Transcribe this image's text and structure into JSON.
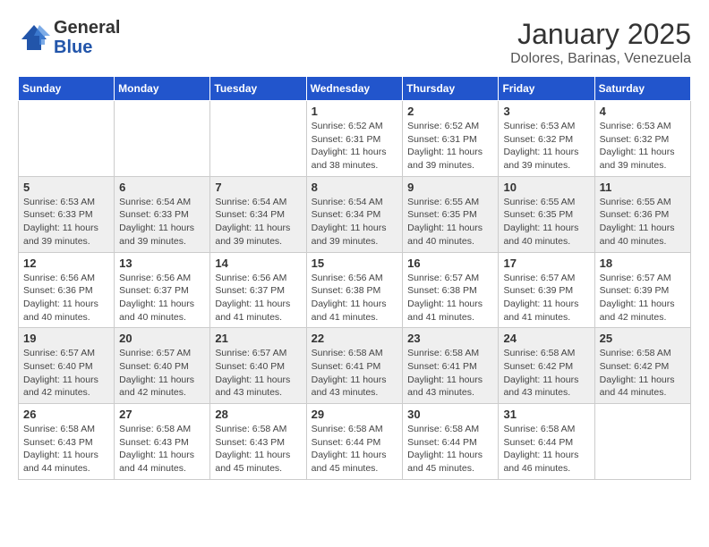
{
  "logo": {
    "general": "General",
    "blue": "Blue"
  },
  "header": {
    "month_year": "January 2025",
    "location": "Dolores, Barinas, Venezuela"
  },
  "days_of_week": [
    "Sunday",
    "Monday",
    "Tuesday",
    "Wednesday",
    "Thursday",
    "Friday",
    "Saturday"
  ],
  "weeks": [
    [
      {
        "day": "",
        "info": ""
      },
      {
        "day": "",
        "info": ""
      },
      {
        "day": "",
        "info": ""
      },
      {
        "day": "1",
        "info": "Sunrise: 6:52 AM\nSunset: 6:31 PM\nDaylight: 11 hours and 38 minutes."
      },
      {
        "day": "2",
        "info": "Sunrise: 6:52 AM\nSunset: 6:31 PM\nDaylight: 11 hours and 39 minutes."
      },
      {
        "day": "3",
        "info": "Sunrise: 6:53 AM\nSunset: 6:32 PM\nDaylight: 11 hours and 39 minutes."
      },
      {
        "day": "4",
        "info": "Sunrise: 6:53 AM\nSunset: 6:32 PM\nDaylight: 11 hours and 39 minutes."
      }
    ],
    [
      {
        "day": "5",
        "info": "Sunrise: 6:53 AM\nSunset: 6:33 PM\nDaylight: 11 hours and 39 minutes."
      },
      {
        "day": "6",
        "info": "Sunrise: 6:54 AM\nSunset: 6:33 PM\nDaylight: 11 hours and 39 minutes."
      },
      {
        "day": "7",
        "info": "Sunrise: 6:54 AM\nSunset: 6:34 PM\nDaylight: 11 hours and 39 minutes."
      },
      {
        "day": "8",
        "info": "Sunrise: 6:54 AM\nSunset: 6:34 PM\nDaylight: 11 hours and 39 minutes."
      },
      {
        "day": "9",
        "info": "Sunrise: 6:55 AM\nSunset: 6:35 PM\nDaylight: 11 hours and 40 minutes."
      },
      {
        "day": "10",
        "info": "Sunrise: 6:55 AM\nSunset: 6:35 PM\nDaylight: 11 hours and 40 minutes."
      },
      {
        "day": "11",
        "info": "Sunrise: 6:55 AM\nSunset: 6:36 PM\nDaylight: 11 hours and 40 minutes."
      }
    ],
    [
      {
        "day": "12",
        "info": "Sunrise: 6:56 AM\nSunset: 6:36 PM\nDaylight: 11 hours and 40 minutes."
      },
      {
        "day": "13",
        "info": "Sunrise: 6:56 AM\nSunset: 6:37 PM\nDaylight: 11 hours and 40 minutes."
      },
      {
        "day": "14",
        "info": "Sunrise: 6:56 AM\nSunset: 6:37 PM\nDaylight: 11 hours and 41 minutes."
      },
      {
        "day": "15",
        "info": "Sunrise: 6:56 AM\nSunset: 6:38 PM\nDaylight: 11 hours and 41 minutes."
      },
      {
        "day": "16",
        "info": "Sunrise: 6:57 AM\nSunset: 6:38 PM\nDaylight: 11 hours and 41 minutes."
      },
      {
        "day": "17",
        "info": "Sunrise: 6:57 AM\nSunset: 6:39 PM\nDaylight: 11 hours and 41 minutes."
      },
      {
        "day": "18",
        "info": "Sunrise: 6:57 AM\nSunset: 6:39 PM\nDaylight: 11 hours and 42 minutes."
      }
    ],
    [
      {
        "day": "19",
        "info": "Sunrise: 6:57 AM\nSunset: 6:40 PM\nDaylight: 11 hours and 42 minutes."
      },
      {
        "day": "20",
        "info": "Sunrise: 6:57 AM\nSunset: 6:40 PM\nDaylight: 11 hours and 42 minutes."
      },
      {
        "day": "21",
        "info": "Sunrise: 6:57 AM\nSunset: 6:40 PM\nDaylight: 11 hours and 43 minutes."
      },
      {
        "day": "22",
        "info": "Sunrise: 6:58 AM\nSunset: 6:41 PM\nDaylight: 11 hours and 43 minutes."
      },
      {
        "day": "23",
        "info": "Sunrise: 6:58 AM\nSunset: 6:41 PM\nDaylight: 11 hours and 43 minutes."
      },
      {
        "day": "24",
        "info": "Sunrise: 6:58 AM\nSunset: 6:42 PM\nDaylight: 11 hours and 43 minutes."
      },
      {
        "day": "25",
        "info": "Sunrise: 6:58 AM\nSunset: 6:42 PM\nDaylight: 11 hours and 44 minutes."
      }
    ],
    [
      {
        "day": "26",
        "info": "Sunrise: 6:58 AM\nSunset: 6:43 PM\nDaylight: 11 hours and 44 minutes."
      },
      {
        "day": "27",
        "info": "Sunrise: 6:58 AM\nSunset: 6:43 PM\nDaylight: 11 hours and 44 minutes."
      },
      {
        "day": "28",
        "info": "Sunrise: 6:58 AM\nSunset: 6:43 PM\nDaylight: 11 hours and 45 minutes."
      },
      {
        "day": "29",
        "info": "Sunrise: 6:58 AM\nSunset: 6:44 PM\nDaylight: 11 hours and 45 minutes."
      },
      {
        "day": "30",
        "info": "Sunrise: 6:58 AM\nSunset: 6:44 PM\nDaylight: 11 hours and 45 minutes."
      },
      {
        "day": "31",
        "info": "Sunrise: 6:58 AM\nSunset: 6:44 PM\nDaylight: 11 hours and 46 minutes."
      },
      {
        "day": "",
        "info": ""
      }
    ]
  ]
}
